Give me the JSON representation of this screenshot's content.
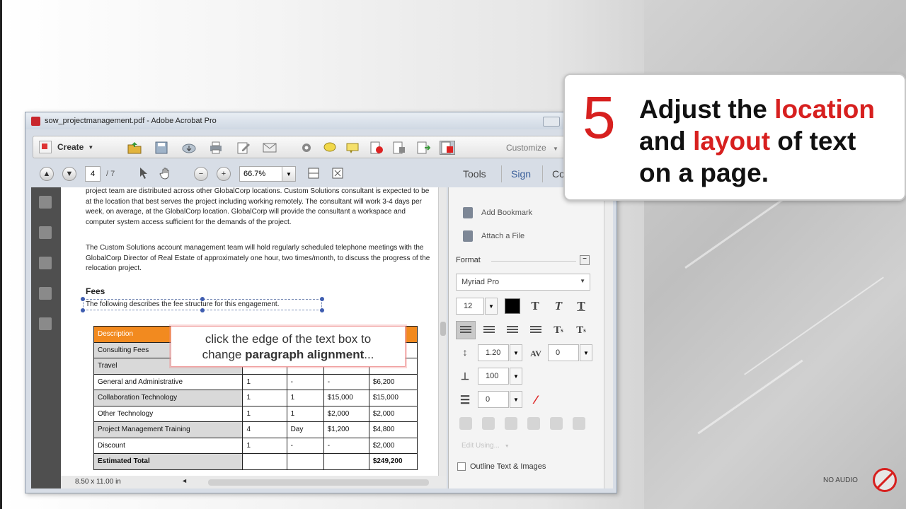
{
  "window": {
    "title": "sow_projectmanagement.pdf - Adobe Acrobat Pro"
  },
  "toolbar": {
    "create_label": "Create",
    "customize_label": "Customize"
  },
  "nav": {
    "page_current": "4",
    "page_total": "/ 7",
    "zoom": "66.7%",
    "tabs": [
      "Tools",
      "Sign",
      "Co"
    ]
  },
  "document": {
    "para1": "project team are distributed across other GlobalCorp locations. Custom Solutions consultant is expected to be at the location that best serves the project including working remotely. The consultant will work 3-4 days per week, on average, at the GlobalCorp location. GlobalCorp will provide the consultant a workspace and computer system access sufficient for the demands of the project.",
    "para2": "The Custom Solutions account management team will hold regularly scheduled telephone meetings with the GlobalCorp Director of Real Estate of approximately one hour, two times/month, to discuss the progress of the relocation project.",
    "fees_heading": "Fees",
    "selected_line": "The following describes the fee structure for this engagement.",
    "table": [
      [
        "Description",
        "",
        "",
        "",
        ""
      ],
      [
        "Consulting Fees",
        "",
        "",
        "",
        ""
      ],
      [
        "Travel",
        "",
        "",
        "",
        ""
      ],
      [
        "General and Administrative",
        "1",
        "-",
        "-",
        "$6,200"
      ],
      [
        "Collaboration Technology",
        "1",
        "1",
        "$15,000",
        "$15,000"
      ],
      [
        "Other Technology",
        "1",
        "1",
        "$2,000",
        "$2,000"
      ],
      [
        "Project Management Training",
        "4",
        "Day",
        "$1,200",
        "$4,800"
      ],
      [
        "Discount",
        "1",
        "-",
        "-",
        "$2,000"
      ],
      [
        "Estimated Total",
        "",
        "",
        "",
        "$249,200"
      ]
    ],
    "page_size": "8.50 x 11.00 in"
  },
  "callout": {
    "line1": "click the edge of the text box to",
    "line2_prefix": "change ",
    "line2_bold": "paragraph alignment",
    "line2_suffix": "..."
  },
  "panel": {
    "add_bookmark": "Add Bookmark",
    "attach_file": "Attach a File",
    "format_label": "Format",
    "font": "Myriad Pro",
    "font_size": "12",
    "line_spacing": "1.20",
    "char_spacing": "0",
    "scale": "100",
    "indent": "0",
    "edit_using": "Edit Using...",
    "outline_label": "Outline Text & Images"
  },
  "step": {
    "number": "5",
    "text_1": "Adjust the ",
    "hl_1": "location",
    "text_2": "and ",
    "hl_2": "layout",
    "text_3": " of text",
    "text_4": "on a page."
  },
  "audio": {
    "label": "NO AUDIO"
  }
}
